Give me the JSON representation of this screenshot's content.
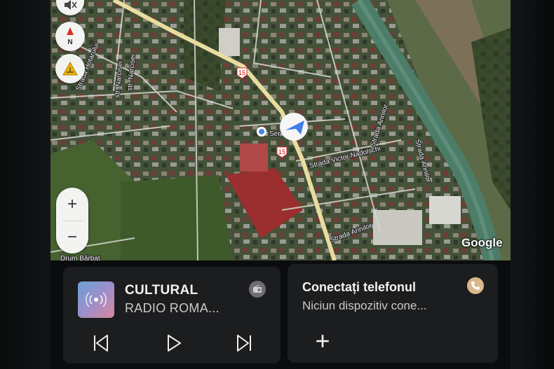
{
  "map": {
    "attribution": "Google",
    "route_badges": [
      "15",
      "15"
    ],
    "streets": [
      {
        "id": "s1",
        "label": "Strada Hotarului"
      },
      {
        "id": "s2",
        "label": "str. Narcisei"
      },
      {
        "id": "s3",
        "label": "str. Narcisei"
      },
      {
        "id": "s4",
        "label": "Strada Victor Nadolschi"
      },
      {
        "id": "s5",
        "label": "Strada Arinilor"
      },
      {
        "id": "s6",
        "label": "Strada Arinilor"
      },
      {
        "id": "s7",
        "label": "Strada Arinilor"
      },
      {
        "id": "s8",
        "label": "Drum Bărbat"
      }
    ],
    "poi_label": "Ser",
    "zoom_in": "+",
    "zoom_out": "−",
    "compass_letter": "N",
    "route_color": "#e9dca0",
    "water_color": "#4c7d68"
  },
  "media": {
    "title": "CULTURAL",
    "subtitle": "RADIO ROMA...",
    "source_icon": "radio-source-icon",
    "controls": [
      "skip-previous-icon",
      "play-icon",
      "skip-next-icon"
    ]
  },
  "phone": {
    "title": "Conectați telefonul",
    "subtitle": "Niciun dispozitiv cone...",
    "add_label": "+",
    "status_icon": "phone-icon"
  }
}
